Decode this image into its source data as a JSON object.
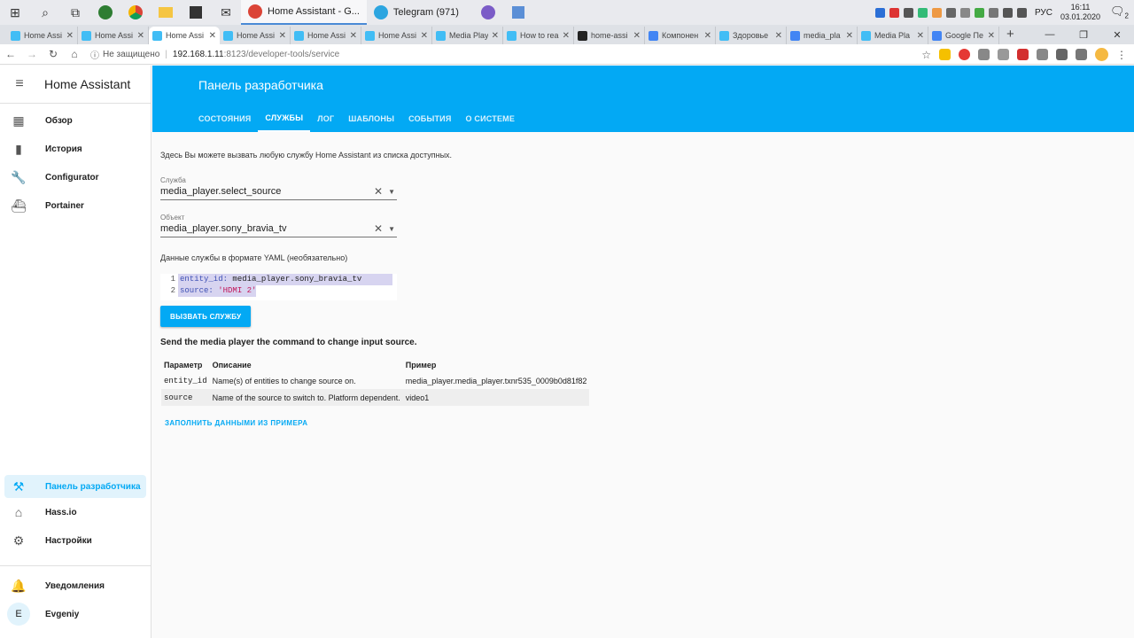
{
  "taskbar": {
    "apps": [
      {
        "label": "Home Assistant - G...",
        "color": "#db4437",
        "active": true
      },
      {
        "label": "Telegram (971)",
        "color": "#2ca5e0",
        "active": false
      }
    ],
    "lang": "РУС",
    "time": "16:11",
    "date": "03.01.2020",
    "notifications": "2"
  },
  "browser": {
    "tabs": [
      {
        "title": "Home Assi",
        "fav": "#41bdf5"
      },
      {
        "title": "Home Assi",
        "fav": "#41bdf5"
      },
      {
        "title": "Home Assi",
        "fav": "#41bdf5",
        "active": true
      },
      {
        "title": "Home Assi",
        "fav": "#41bdf5"
      },
      {
        "title": "Home Assi",
        "fav": "#41bdf5"
      },
      {
        "title": "Home Assi",
        "fav": "#41bdf5"
      },
      {
        "title": "Media Playe",
        "fav": "#41bdf5"
      },
      {
        "title": "How to rea",
        "fav": "#41bdf5"
      },
      {
        "title": "home-assi",
        "fav": "#222222"
      },
      {
        "title": "Компонен",
        "fav": "#4285f4"
      },
      {
        "title": "Здоровье",
        "fav": "#41bdf5"
      },
      {
        "title": "media_pla",
        "fav": "#4285f4"
      },
      {
        "title": "Media Pla",
        "fav": "#41bdf5"
      },
      {
        "title": "Google Пе",
        "fav": "#4285f4"
      }
    ],
    "insecure_label": "Не защищено",
    "url_host": "192.168.1.11",
    "url_path": ":8123/developer-tools/service"
  },
  "sidebar": {
    "title": "Home Assistant",
    "items": [
      {
        "label": "Обзор",
        "icon": "▦"
      },
      {
        "label": "История",
        "icon": "▮"
      },
      {
        "label": "Configurator",
        "icon": "🔧"
      },
      {
        "label": "Portainer",
        "icon": "⛴"
      }
    ],
    "bottom_items": [
      {
        "label": "Панель разработчика",
        "icon": "⚒",
        "selected": true
      },
      {
        "label": "Hass.io",
        "icon": "⌂"
      },
      {
        "label": "Настройки",
        "icon": "⚙"
      }
    ],
    "notifications_label": "Уведомления",
    "user_name": "Evgeniy",
    "user_initial": "E"
  },
  "header": {
    "title": "Панель разработчика",
    "tabs": [
      "СОСТОЯНИЯ",
      "СЛУЖБЫ",
      "ЛОГ",
      "ШАБЛОНЫ",
      "СОБЫТИЯ",
      "О СИСТЕМЕ"
    ],
    "active_tab": "СЛУЖБЫ"
  },
  "main": {
    "intro": "Здесь Вы можете вызвать любую службу Home Assistant из списка доступных.",
    "service_label": "Служба",
    "service_value": "media_player.select_source",
    "entity_label": "Объект",
    "entity_value": "media_player.sony_bravia_tv",
    "yaml_label": "Данные службы в формате YAML (необязательно)",
    "yaml": {
      "line1_key": "entity_id:",
      "line1_val": " media_player.sony_bravia_tv",
      "line2_key": "source:",
      "line2_val": " 'HDMI 2'"
    },
    "call_button": "ВЫЗВАТЬ СЛУЖБУ",
    "description": "Send the media player the command to change input source.",
    "table": {
      "headers": [
        "Параметр",
        "Описание",
        "Пример"
      ],
      "rows": [
        [
          "entity_id",
          "Name(s) of entities to change source on.",
          "media_player.media_player.txnr535_0009b0d81f82"
        ],
        [
          "source",
          "Name of the source to switch to. Platform dependent.",
          "video1"
        ]
      ]
    },
    "fill_example": "ЗАПОЛНИТЬ ДАННЫМИ ИЗ ПРИМЕРА"
  }
}
